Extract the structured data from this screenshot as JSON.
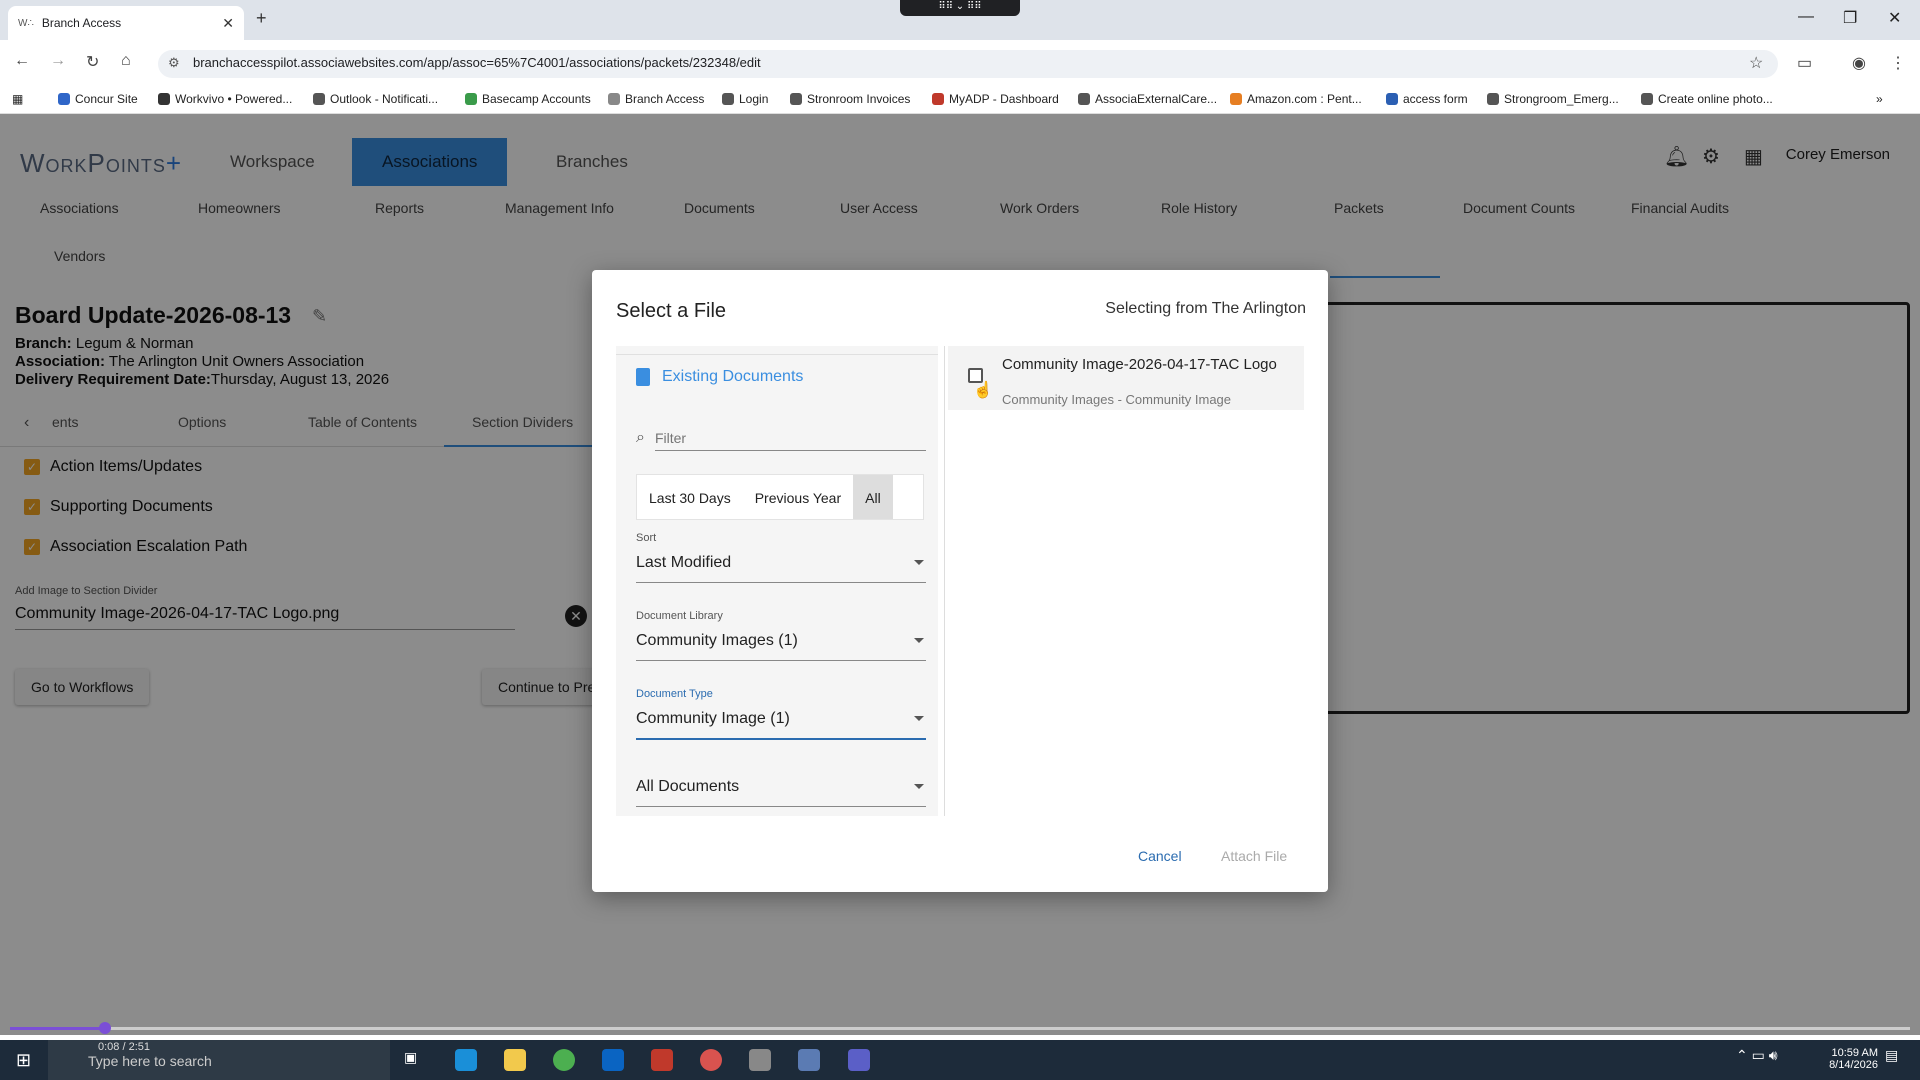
{
  "browser": {
    "tab_title": "Branch Access",
    "tab_favicon": "W∴",
    "url": "branchaccesspilot.associawebsites.com/app/assoc=65%7C4001/associations/packets/232348/edit",
    "bookmarks": [
      {
        "label": "Concur Site",
        "color": "#2f66c8"
      },
      {
        "label": "Workvivo • Powered...",
        "color": "#333"
      },
      {
        "label": "Outlook - Notificati...",
        "color": "#555"
      },
      {
        "label": "Basecamp Accounts",
        "color": "#3a9b4a"
      },
      {
        "label": "Branch Access",
        "color": "#888"
      },
      {
        "label": "Login",
        "color": "#555"
      },
      {
        "label": "Stronroom Invoices",
        "color": "#555"
      },
      {
        "label": "MyADP - Dashboard",
        "color": "#c0392b"
      },
      {
        "label": "AssociaExternalCare...",
        "color": "#555"
      },
      {
        "label": "Amazon.com : Pent...",
        "color": "#e67e22"
      },
      {
        "label": "access form",
        "color": "#2b5fb3"
      },
      {
        "label": "Strongroom_Emerg...",
        "color": "#555"
      },
      {
        "label": "Create online photo...",
        "color": "#555"
      }
    ]
  },
  "app": {
    "logo_main": "WorkPoints",
    "logo_plus": "+",
    "top_nav": [
      "Workspace",
      "Associations",
      "Branches"
    ],
    "user_name": "Corey Emerson",
    "sub_nav": [
      "Associations",
      "Homeowners",
      "Reports",
      "Management Info",
      "Documents",
      "User Access",
      "Work Orders",
      "Role History",
      "Packets",
      "Document Counts",
      "Financial Audits",
      "Vendors"
    ]
  },
  "packet": {
    "title": "Board Update-2026-08-13",
    "branch_label": "Branch:",
    "branch_value": "Legum & Norman",
    "association_label": "Association:",
    "association_value": "The Arlington Unit Owners Association",
    "delivery_label": "Delivery Requirement Date:",
    "delivery_value": "Thursday, August 13, 2026",
    "tabs": [
      "ents",
      "Options",
      "Table of Contents",
      "Section Dividers"
    ],
    "checkboxes": [
      "Action Items/Updates",
      "Supporting Documents",
      "Association Escalation Path"
    ],
    "image_label": "Add Image to Section Divider",
    "image_value": "Community Image-2026-04-17-TAC Logo.png",
    "btn_workflows": "Go to Workflows",
    "btn_continue": "Continue to Pre"
  },
  "dialog": {
    "title": "Select a File",
    "selecting_from": "Selecting from The Arlington",
    "existing_docs": "Existing Documents",
    "filter_placeholder": "Filter",
    "range_options": [
      "Last 30 Days",
      "Previous Year",
      "All"
    ],
    "sort_label": "Sort",
    "sort_value": "Last Modified",
    "library_label": "Document Library",
    "library_value": "Community Images (1)",
    "type_label": "Document Type",
    "type_value": "Community Image (1)",
    "docs_value": "All Documents",
    "result_title": "Community Image-2026-04-17-TAC Logo",
    "result_sub": "Community Images - Community Image",
    "cancel": "Cancel",
    "attach": "Attach File"
  },
  "video": {
    "timecode": "0:08 / 2:51",
    "progress": 0.05
  },
  "taskbar": {
    "search_placeholder": "Type here to search",
    "time": "10:59 AM",
    "date": "8/14/2026"
  }
}
